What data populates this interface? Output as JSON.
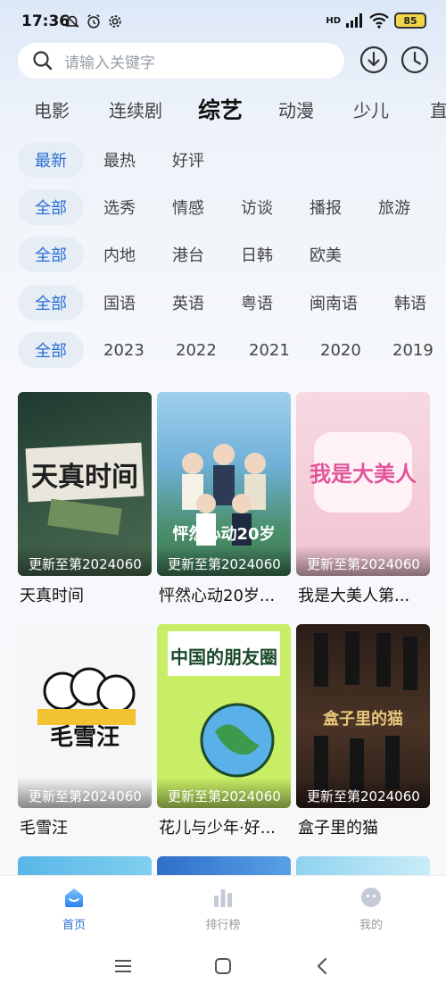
{
  "status": {
    "time": "17:36",
    "battery": "85",
    "signal": "HD"
  },
  "search": {
    "placeholder": "请输入关键字"
  },
  "header_icons": [
    "download-icon",
    "history-icon"
  ],
  "category_tabs": [
    "电影",
    "连续剧",
    "综艺",
    "动漫",
    "少儿",
    "直"
  ],
  "active_category": "综艺",
  "filters": {
    "sort": [
      "最新",
      "最热",
      "好评"
    ],
    "type": [
      "全部",
      "选秀",
      "情感",
      "访谈",
      "播报",
      "旅游"
    ],
    "region": [
      "全部",
      "内地",
      "港台",
      "日韩",
      "欧美"
    ],
    "language": [
      "全部",
      "国语",
      "英语",
      "粤语",
      "闽南语",
      "韩语"
    ],
    "year": [
      "全部",
      "2023",
      "2022",
      "2021",
      "2020",
      "2019"
    ]
  },
  "cards": [
    {
      "title": "天真时间",
      "update": "更新至第2024060",
      "poster_text": "天真时间",
      "bg": "#2f4a3c",
      "accent": "#d8dcd6"
    },
    {
      "title": "怦然心动20岁...",
      "update": "更新至第2024060",
      "poster_text": "怦然心动20岁",
      "bg": "#6fa8c9",
      "accent": "#f3efe2"
    },
    {
      "title": "我是大美人第...",
      "update": "更新至第2024060",
      "poster_text": "我是大美人",
      "bg": "#f2c9d4",
      "accent": "#e2559a"
    },
    {
      "title": "毛雪汪",
      "update": "更新至第2024060",
      "poster_text": "毛雪汪",
      "bg": "#f4f4f4",
      "accent": "#111111"
    },
    {
      "title": "花儿与少年·好...",
      "update": "更新至第2024060",
      "poster_text": "中国的朋友圈",
      "bg": "#c9ef6a",
      "accent": "#1b4a2b"
    },
    {
      "title": "盒子里的猫",
      "update": "更新至第2024060",
      "poster_text": "盒子里的猫",
      "bg": "#3a2a22",
      "accent": "#e8c77a"
    }
  ],
  "bottom_nav": [
    {
      "label": "首页",
      "icon": "home-icon",
      "active": true
    },
    {
      "label": "排行榜",
      "icon": "chart-icon",
      "active": false
    },
    {
      "label": "我的",
      "icon": "face-icon",
      "active": false
    }
  ],
  "colors": {
    "accent": "#2a6fd1",
    "chip_bg": "#e7edf5"
  }
}
